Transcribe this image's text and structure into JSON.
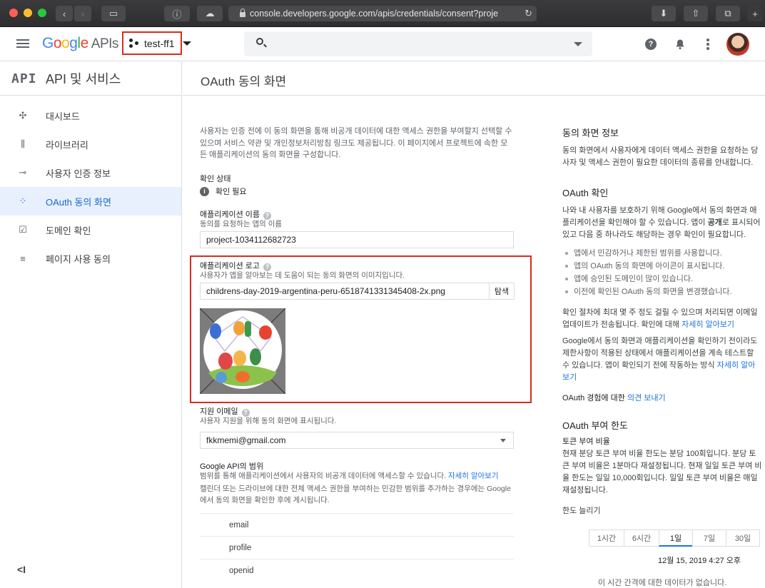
{
  "browser": {
    "url": "console.developers.google.com/apis/credentials/consent?proje"
  },
  "header": {
    "logo_google": "Google",
    "logo_apis": "APIs",
    "project_name": "test-ff1"
  },
  "sidebar": {
    "mark": "API",
    "title": "API 및 서비스",
    "items": [
      {
        "label": "대시보드",
        "icon": "dashboard-icon"
      },
      {
        "label": "라이브러리",
        "icon": "library-icon"
      },
      {
        "label": "사용자 인증 정보",
        "icon": "key-icon"
      },
      {
        "label": "OAuth 동의 화면",
        "icon": "consent-icon"
      },
      {
        "label": "도메인 확인",
        "icon": "domain-check-icon"
      },
      {
        "label": "페이지 사용 동의",
        "icon": "page-usage-icon"
      }
    ],
    "collapse": "<I"
  },
  "page": {
    "title": "OAuth 동의 화면"
  },
  "form": {
    "intro": "사용자는 인증 전에 이 동의 화면을 통해 비공개 데이터에 대한 액세스 권한을 부여할지 선택할 수 있으며 서비스 약관 및 개인정보처리방침 링크도 제공됩니다. 이 페이지에서 프로젝트에 속한 모든 애플리케이션의 동의 화면을 구성합니다.",
    "verify_label": "확인 상태",
    "verify_value": "확인 필요",
    "app_name_label": "애플리케이션 이름",
    "app_name_sub": "동의를 요청하는 앱의 이름",
    "app_name_value": "project-1034112682723",
    "logo_label": "애플리케이션 로고",
    "logo_sub": "사용자가 앱을 알아보는 데 도움이 되는 동의 화면의 이미지입니다.",
    "logo_file": "childrens-day-2019-argentina-peru-6518741331345408-2x.png",
    "browse_label": "탐색",
    "email_label": "지원 이메일",
    "email_sub": "사용자 지원을 위해 동의 화면에 표시됩니다.",
    "email_value": "fkkmemi@gmail.com",
    "scopes_label": "Google API의 범위",
    "scopes_sub": "범위를 통해 애플리케이션에서 사용자의 비공개 데이터에 액세스할 수 있습니다.",
    "scopes_link": "자세히 알아보기",
    "scopes_note": "캘린더 또는 드라이브에 대한 전체 액세스 권한을 부여하는 민감한 범위를 추가하는 경우에는 Google에서 동의 화면을 확인한 후에 게시됩니다.",
    "scopes": [
      "email",
      "profile",
      "openid"
    ]
  },
  "right": {
    "consent_h": "동의 화면 정보",
    "consent_p": "동의 화면에서 사용자에게 데이터 액세스 권한을 요청하는 당사자 및 액세스 권한이 필요한 데이터의 종류를 안내합니다.",
    "verify_h": "OAuth 확인",
    "verify_p1": "나와 내 사용자를 보호하기 위해 Google에서 동의 화면과 애플리케이션을 확인해야 할 수 있습니다. 앱이",
    "verify_p_bold": "공개",
    "verify_p2": "로 표시되어 있고 다음 중 하나라도 해당하는 경우 확인이 필요합니다.",
    "bullets": [
      "앱에서 민감하거나 제한된 범위를 사용합니다.",
      "앱의 OAuth 동의 화면에 아이콘이 표시됩니다.",
      "앱에 승인된 도메인이 많이 있습니다.",
      "이전에 확인된 OAuth 동의 화면을 변경했습니다."
    ],
    "verify_p3": "확인 절차에 최대 몇 주 정도 걸릴 수 있으며 처리되면 이메일 업데이트가 전송됩니다. 확인에 대해",
    "verify_p3_link": "자세히 알아보기",
    "verify_p4": "Google에서 동의 화면과 애플리케이션을 확인하기 전이라도 제한사항이 적용된 상태에서 애플리케이션을 계속 테스트할 수 있습니다. 앱이 확인되기 전에 작동하는 방식",
    "verify_p4_link": "자세히 알아보기",
    "feedback_pre": "OAuth 경험에 대한",
    "feedback_link": "의견 보내기",
    "quota_h": "OAuth 부여 한도",
    "quota_sub": "토큰 부여 비율",
    "quota_p": "현재 분당 토큰 부여 비율 한도는 분당 100회입니다. 분당 토큰 부여 비율은 1분마다 재설정됩니다. 현재 일일 토큰 부여 비율 한도는 일일 10,000회입니다. 일일 토큰 부여 비율은 매일 재설정됩니다.",
    "quota_link": "한도 늘리기",
    "tabs": [
      "1시간",
      "6시간",
      "1일",
      "7일",
      "30일"
    ],
    "selected_tab": "1일",
    "date": "12월 15, 2019 4:27 오후",
    "no_data": "이 시간 간격에 대한 데이터가 없습니다."
  }
}
